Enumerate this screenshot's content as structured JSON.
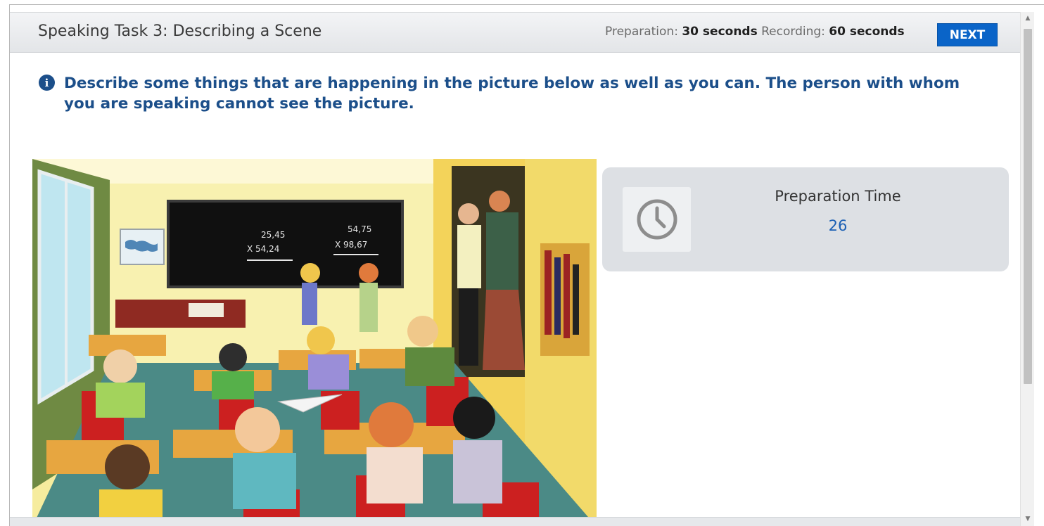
{
  "header": {
    "title": "Speaking Task 3: Describing a Scene",
    "preparation_label": "Preparation:",
    "preparation_value": "30 seconds",
    "recording_label": "Recording:",
    "recording_value": "60 seconds",
    "next_label": "NEXT"
  },
  "instruction": {
    "icon": "info-icon",
    "text": "Describe some things that are happening in the picture below as well as you can. The person with whom you are speaking cannot see the picture."
  },
  "scene": {
    "board_left_top": "25,45",
    "board_left_bottom": "X 54,24",
    "board_right_top": "54,75",
    "board_right_bottom": "X 98,67"
  },
  "prep_panel": {
    "icon": "clock-icon",
    "label": "Preparation Time",
    "value": "26"
  },
  "colors": {
    "accent": "#0a64c8",
    "instruction_text": "#1c4f8a",
    "timer_value": "#1a5fb4",
    "panel_bg": "#dde0e4"
  }
}
